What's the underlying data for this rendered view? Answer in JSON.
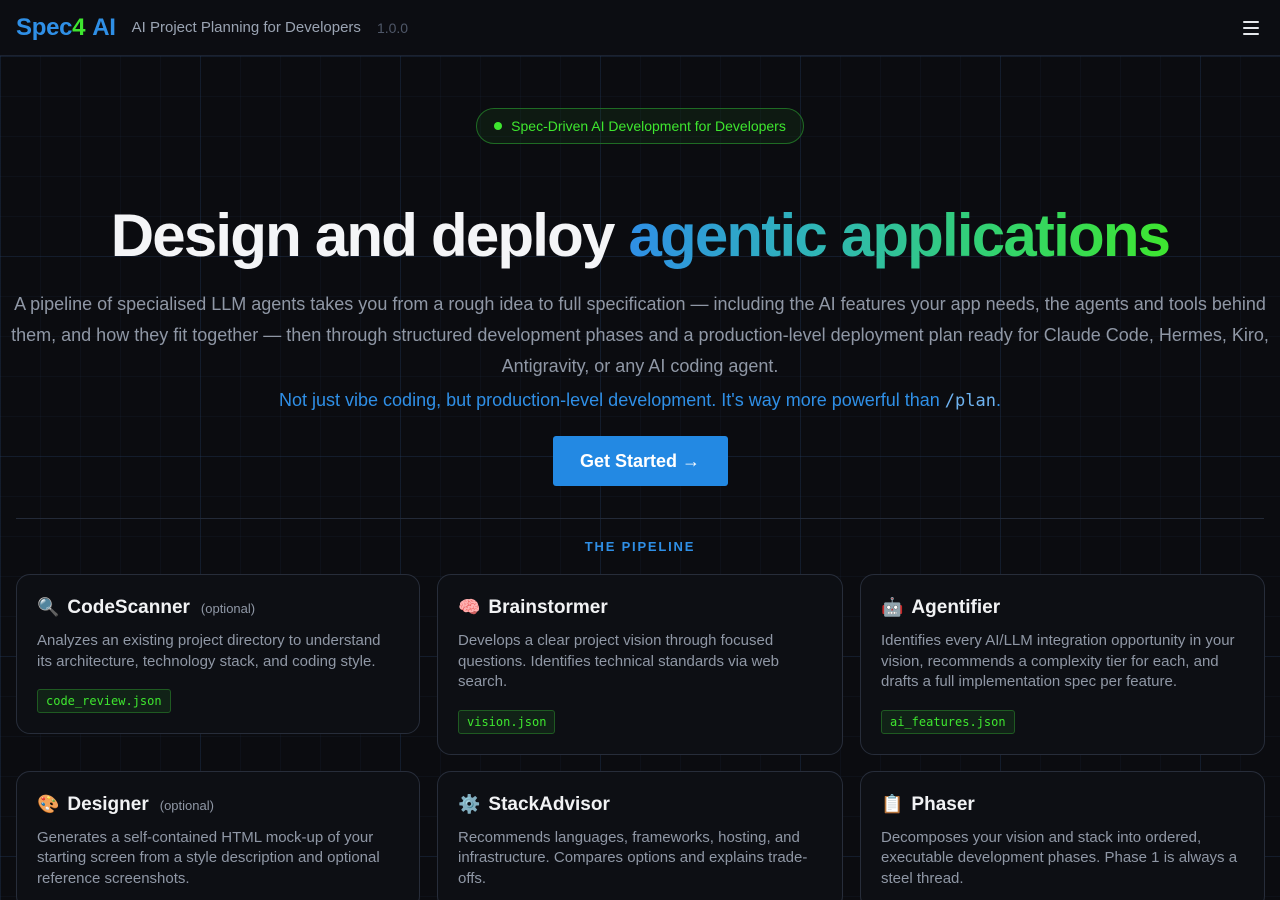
{
  "header": {
    "logo_spec": "Spec",
    "logo_four": "4",
    "logo_ai": "AI",
    "tagline": "AI Project Planning for Developers",
    "version": "1.0.0",
    "menu_icon": "hamburger-icon"
  },
  "hero": {
    "pill": "Spec-Driven AI Development for Developers",
    "title_plain": "Design and deploy ",
    "title_gradient": "agentic applications",
    "description": "A pipeline of specialised LLM agents takes you from a rough idea to full specification — including the AI features your app needs, the agents and tools behind them, and how they fit together — then through structured development phases and a production-level deployment plan ready for Claude Code, Hermes, Kiro, Antigravity, or any AI coding agent.",
    "sub_text": "Not just vibe coding, but production-level development. It's way more powerful than ",
    "sub_code": "/plan",
    "sub_end": ".",
    "cta": "Get Started →"
  },
  "pipeline": {
    "title": "THE PIPELINE",
    "cards": [
      {
        "icon": "🔍",
        "title": "CodeScanner",
        "optional": "(optional)",
        "desc": "Analyzes an existing project directory to understand its architecture, technology stack, and coding style.",
        "file": "code_review.json"
      },
      {
        "icon": "🧠",
        "title": "Brainstormer",
        "optional": "",
        "desc": "Develops a clear project vision through focused questions. Identifies technical standards via web search.",
        "file": "vision.json"
      },
      {
        "icon": "🤖",
        "title": "Agentifier",
        "optional": "",
        "desc": "Identifies every AI/LLM integration opportunity in your vision, recommends a complexity tier for each, and drafts a full implementation spec per feature.",
        "file": "ai_features.json"
      },
      {
        "icon": "🎨",
        "title": "Designer",
        "optional": "(optional)",
        "desc": "Generates a self-contained HTML mock-up of your starting screen from a style description and optional reference screenshots.",
        "file": ""
      },
      {
        "icon": "⚙️",
        "title": "StackAdvisor",
        "optional": "",
        "desc": "Recommends languages, frameworks, hosting, and infrastructure. Compares options and explains trade-offs.",
        "file": ""
      },
      {
        "icon": "📋",
        "title": "Phaser",
        "optional": "",
        "desc": "Decomposes your vision and stack into ordered, executable development phases. Phase 1 is always a steel thread.",
        "file": ""
      }
    ]
  }
}
